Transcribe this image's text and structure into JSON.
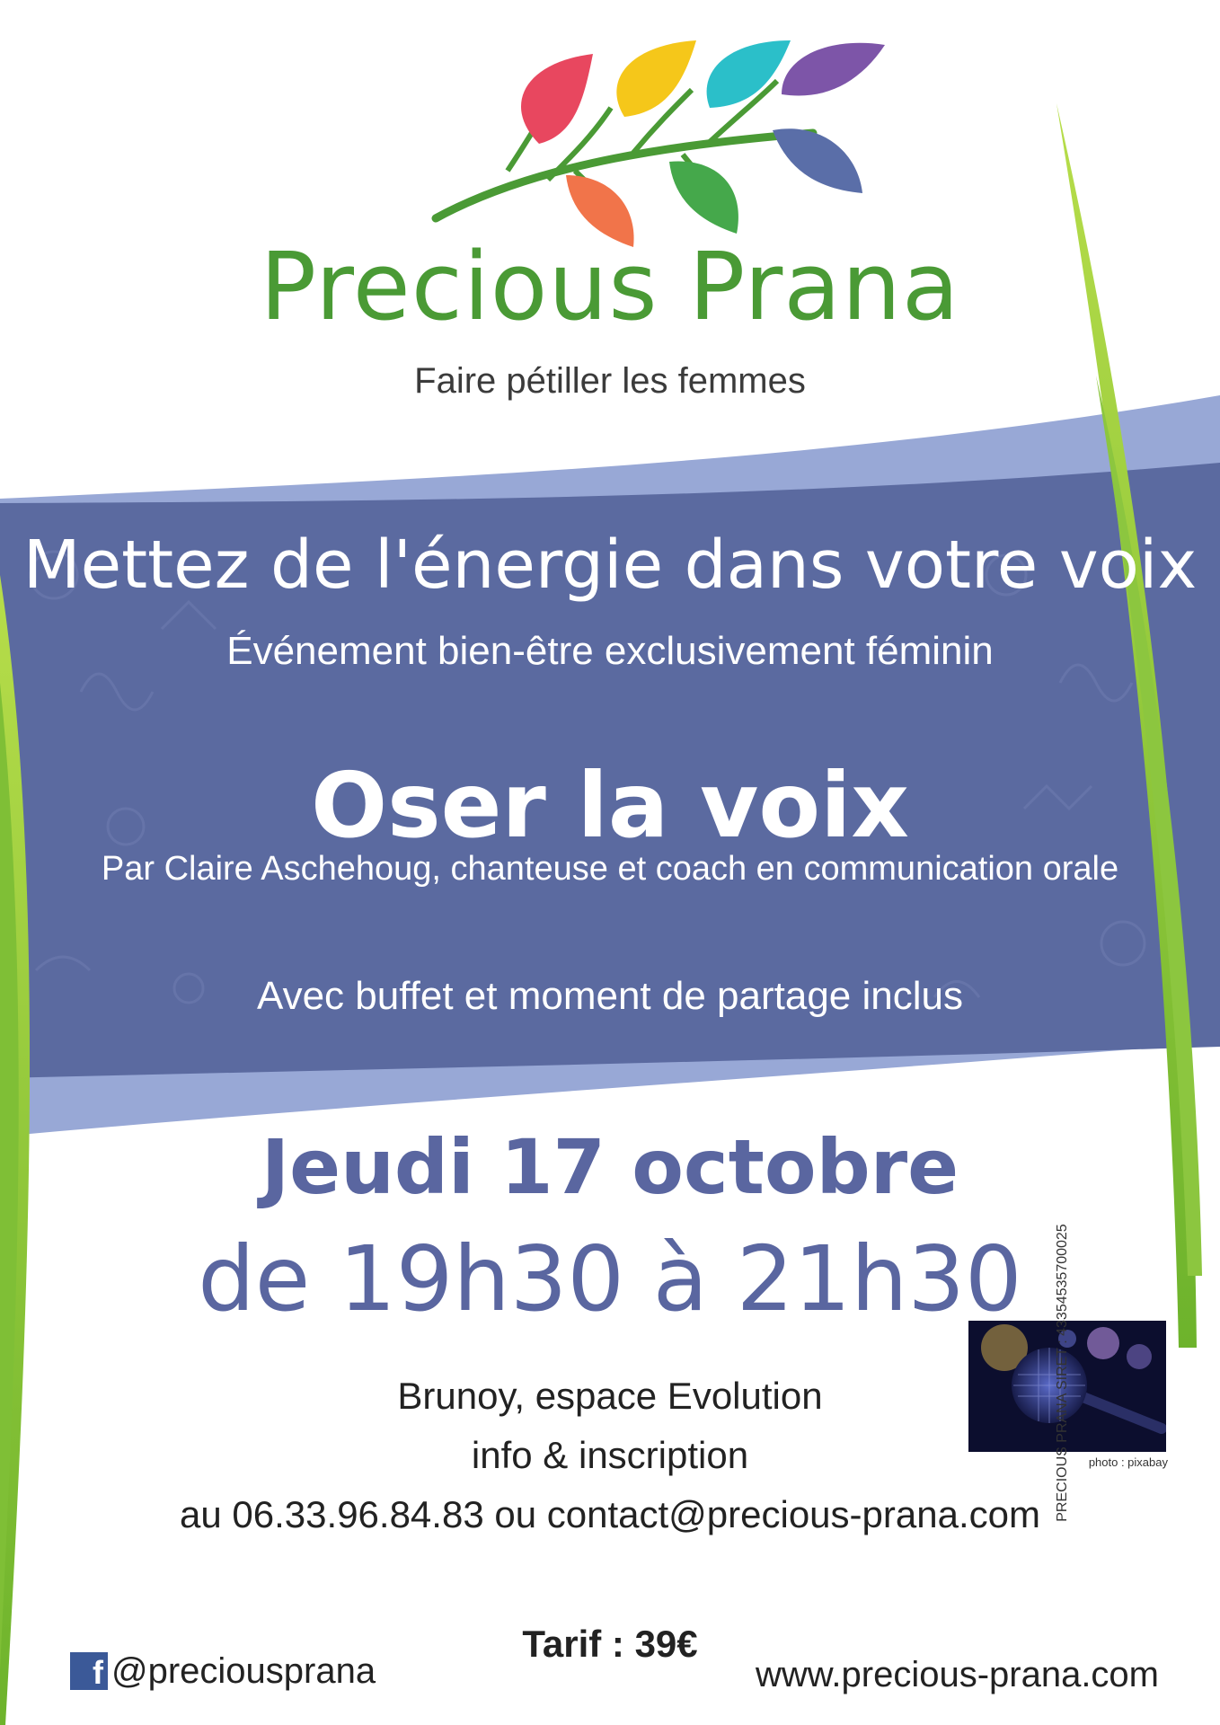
{
  "brand": {
    "name": "Precious Prana",
    "tagline": "Faire pétiller les femmes",
    "logo_icon": "leafy-branch-icon",
    "leaf_colors": [
      "#e8475f",
      "#f5c71a",
      "#2bbfc9",
      "#7d55a8",
      "#f1744a",
      "#45a84b",
      "#5a6ea8"
    ],
    "green": "#4a9a35"
  },
  "banner": {
    "headline": "Mettez de l'énergie dans votre voix",
    "subheadline": "Événement bien-être exclusivement féminin",
    "workshop_title": "Oser la voix",
    "speaker": "Par Claire Aschehoug, chanteuse et coach en communication orale",
    "buffet": "Avec buffet et moment de partage inclus",
    "band_color": "#5b6aa0",
    "band_light_color": "#98a8d6"
  },
  "event": {
    "date": "Jeudi 17 octobre",
    "time": "de 19h30 à 21h30",
    "location": "Brunoy, espace Evolution",
    "info": "info & inscription",
    "contact": "au 06.33.96.84.83 ou contact@precious-prana.com",
    "accent_color": "#5a66a0"
  },
  "photo": {
    "credit": "photo : pixabay",
    "icon": "microphone-icon"
  },
  "legal": {
    "text": "PRECIOUS PRANA  SIRET : 43354535700025"
  },
  "footer": {
    "tarif": "Tarif : 39€",
    "facebook_icon_letter": "f",
    "facebook_handle": "@preciousprana",
    "website": "www.precious-prana.com"
  }
}
